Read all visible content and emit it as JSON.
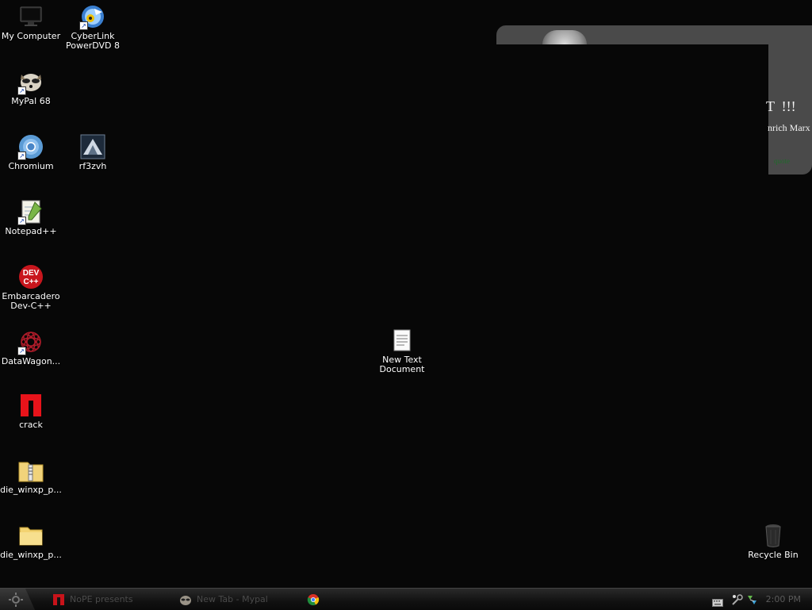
{
  "desktop": {
    "icons": [
      {
        "label": "My Computer",
        "icon": "computer-icon"
      },
      {
        "label": "CyberLink\nPowerDVD 8",
        "icon": "powerdvd-icon"
      },
      {
        "label": "MyPal 68",
        "icon": "mypal-icon"
      },
      {
        "label": "Chromium",
        "icon": "chromium-icon"
      },
      {
        "label": "rf3zvh",
        "icon": "rf3zvh-icon"
      },
      {
        "label": "Notepad++",
        "icon": "notepadpp-icon"
      },
      {
        "label": "Embarcadero\nDev-C++",
        "icon": "devcpp-icon"
      },
      {
        "label": "DataWagon...",
        "icon": "datawagon-icon"
      },
      {
        "label": "crack",
        "icon": "opera-icon"
      },
      {
        "label": "die_winxp_p...",
        "icon": "zip-folder-icon"
      },
      {
        "label": "die_winxp_p...",
        "icon": "folder-icon"
      },
      {
        "label": "New Text\nDocument",
        "icon": "text-document-icon"
      },
      {
        "label": "Recycle Bin",
        "icon": "recycle-bin-icon"
      }
    ]
  },
  "gadget": {
    "headline": "T  !!!",
    "author": "nrich Marx",
    "footer": "quote"
  },
  "taskbar": {
    "tasks": [
      {
        "label": "NoPE presents",
        "icon": "opera-icon"
      },
      {
        "label": "New Tab - Mypal",
        "icon": "mypal-icon"
      },
      {
        "label": "",
        "icon": "chrome-icon"
      }
    ],
    "clock": "2:00 PM"
  },
  "colors": {
    "desktop": "#070707",
    "label_text": "#ffffff",
    "taskbar_text": "#4a4a4a",
    "gadget_bg": "#4a4a4a"
  }
}
